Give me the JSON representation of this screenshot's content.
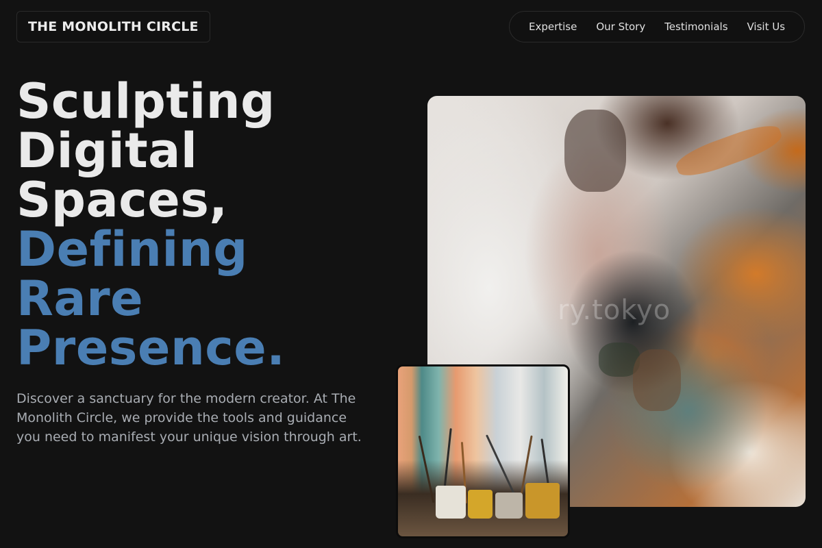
{
  "brand": {
    "name": "THE MONOLITH CIRCLE"
  },
  "nav": {
    "items": [
      {
        "label": "Expertise"
      },
      {
        "label": "Our Story"
      },
      {
        "label": "Testimonials"
      },
      {
        "label": "Visit Us"
      }
    ]
  },
  "hero": {
    "title_lines": [
      "Sculpting",
      "Digital",
      "Spaces,",
      "Defining",
      "Rare",
      "Presence."
    ],
    "description": "Discover a sanctuary for the modern creator. At The Monolith Circle, we provide the tools and guidance you need to manifest your unique vision through art."
  },
  "images": {
    "main_watermark": "ry.tokyo"
  },
  "colors": {
    "background": "#121212",
    "accent_blue": "#4a7eb3",
    "text_light": "#eaeaea",
    "text_muted": "#a9adb3"
  }
}
